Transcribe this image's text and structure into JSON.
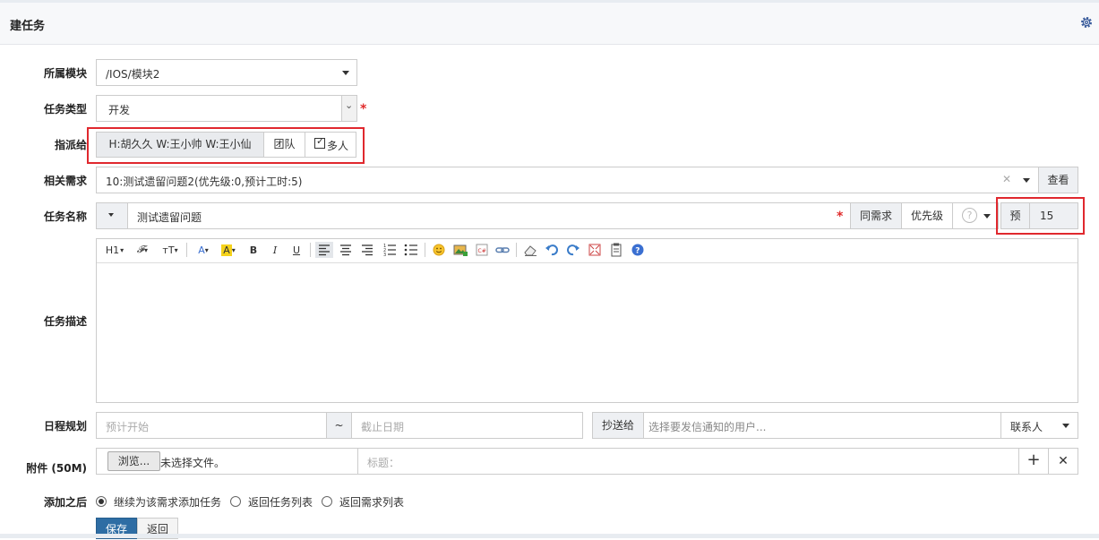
{
  "header": {
    "title": "建任务"
  },
  "labels": {
    "module": "所属模块",
    "type": "任务类型",
    "assign": "指派给",
    "story": "相关需求",
    "name": "任务名称",
    "desc": "任务描述",
    "schedule": "日程规划",
    "attachment": "附件 (50M)",
    "after": "添加之后"
  },
  "module": {
    "value": "/IOS/模块2"
  },
  "task_type": {
    "value": "开发"
  },
  "assign": {
    "value": "H:胡久久 W:王小帅 W:王小仙",
    "team_label": "团队",
    "multi_label": "多人",
    "multi_checked": true
  },
  "story": {
    "value": "10:测试遗留问题2(优先级:0,预计工时:5)",
    "clear": "✕",
    "view_label": "查看"
  },
  "task_name": {
    "value": "测试遗留问题",
    "same_story_label": "同需求",
    "priority_label": "优先级",
    "estimate_label": "预",
    "estimate_value": "15"
  },
  "toolbar": {
    "heading": "H1",
    "font_family": "𝓕",
    "font_size": "тT",
    "font_color": "A",
    "bg_color": "A",
    "bold": "B",
    "italic": "I",
    "underline": "U"
  },
  "schedule": {
    "start_placeholder": "预计开始",
    "tilde": "~",
    "end_placeholder": "截止日期",
    "mailto_label": "抄送给",
    "mailto_placeholder": "选择要发信通知的用户...",
    "contacts_label": "联系人"
  },
  "attachment": {
    "browse_label": "浏览...",
    "no_file": "未选择文件。",
    "title_placeholder": "标题：",
    "add": "+",
    "remove": "✕"
  },
  "after": {
    "options": [
      "继续为该需求添加任务",
      "返回任务列表",
      "返回需求列表"
    ],
    "selected": 0
  },
  "actions": {
    "save_label": "保存",
    "back_label": "返回"
  },
  "colors": {
    "accent": "#2e6da4",
    "required": "#e02b2b",
    "highlight": "#e0282e"
  }
}
